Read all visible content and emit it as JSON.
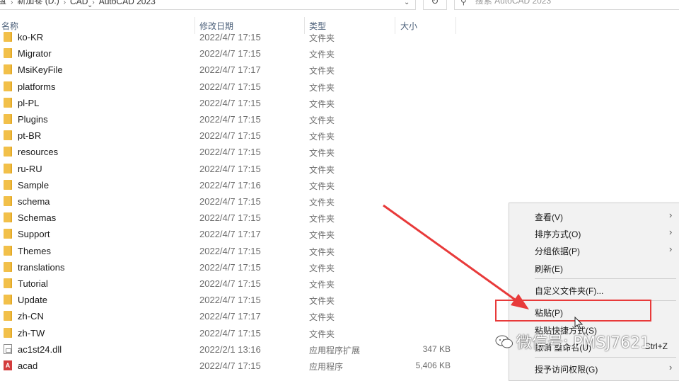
{
  "address": {
    "crumbs": [
      "盘",
      "新加卷 (D:)",
      "CAD",
      "AutoCAD 2023"
    ],
    "search_placeholder": "搜索 AutoCAD 2023"
  },
  "columns": {
    "name": "名称",
    "date": "修改日期",
    "type": "类型",
    "size": "大小"
  },
  "files": [
    {
      "name": "ko-KR",
      "date": "2022/4/7 17:15",
      "type": "文件夹",
      "size": "",
      "icon": "folder-icon"
    },
    {
      "name": "Migrator",
      "date": "2022/4/7 17:15",
      "type": "文件夹",
      "size": "",
      "icon": "folder-icon"
    },
    {
      "name": "MsiKeyFile",
      "date": "2022/4/7 17:17",
      "type": "文件夹",
      "size": "",
      "icon": "folder-icon"
    },
    {
      "name": "platforms",
      "date": "2022/4/7 17:15",
      "type": "文件夹",
      "size": "",
      "icon": "folder-icon"
    },
    {
      "name": "pl-PL",
      "date": "2022/4/7 17:15",
      "type": "文件夹",
      "size": "",
      "icon": "folder-icon"
    },
    {
      "name": "Plugins",
      "date": "2022/4/7 17:15",
      "type": "文件夹",
      "size": "",
      "icon": "folder-icon"
    },
    {
      "name": "pt-BR",
      "date": "2022/4/7 17:15",
      "type": "文件夹",
      "size": "",
      "icon": "folder-icon"
    },
    {
      "name": "resources",
      "date": "2022/4/7 17:15",
      "type": "文件夹",
      "size": "",
      "icon": "folder-icon"
    },
    {
      "name": "ru-RU",
      "date": "2022/4/7 17:15",
      "type": "文件夹",
      "size": "",
      "icon": "folder-icon"
    },
    {
      "name": "Sample",
      "date": "2022/4/7 17:16",
      "type": "文件夹",
      "size": "",
      "icon": "folder-icon"
    },
    {
      "name": "schema",
      "date": "2022/4/7 17:15",
      "type": "文件夹",
      "size": "",
      "icon": "folder-icon"
    },
    {
      "name": "Schemas",
      "date": "2022/4/7 17:15",
      "type": "文件夹",
      "size": "",
      "icon": "folder-icon"
    },
    {
      "name": "Support",
      "date": "2022/4/7 17:17",
      "type": "文件夹",
      "size": "",
      "icon": "folder-icon"
    },
    {
      "name": "Themes",
      "date": "2022/4/7 17:15",
      "type": "文件夹",
      "size": "",
      "icon": "folder-icon"
    },
    {
      "name": "translations",
      "date": "2022/4/7 17:15",
      "type": "文件夹",
      "size": "",
      "icon": "folder-icon"
    },
    {
      "name": "Tutorial",
      "date": "2022/4/7 17:15",
      "type": "文件夹",
      "size": "",
      "icon": "folder-icon"
    },
    {
      "name": "Update",
      "date": "2022/4/7 17:15",
      "type": "文件夹",
      "size": "",
      "icon": "folder-icon"
    },
    {
      "name": "zh-CN",
      "date": "2022/4/7 17:17",
      "type": "文件夹",
      "size": "",
      "icon": "folder-icon"
    },
    {
      "name": "zh-TW",
      "date": "2022/4/7 17:15",
      "type": "文件夹",
      "size": "",
      "icon": "folder-icon"
    },
    {
      "name": "ac1st24.dll",
      "date": "2022/2/1 13:16",
      "type": "应用程序扩展",
      "size": "347 KB",
      "icon": "dll-file-icon"
    },
    {
      "name": "acad",
      "date": "2022/4/7 17:15",
      "type": "应用程序",
      "size": "5,406 KB",
      "icon": "autocad-app-icon"
    }
  ],
  "context_menu": {
    "items": [
      {
        "label": "查看(V)",
        "submenu": true
      },
      {
        "label": "排序方式(O)",
        "submenu": true
      },
      {
        "label": "分组依据(P)",
        "submenu": true
      },
      {
        "label": "刷新(E)",
        "submenu": false
      },
      {
        "label": "自定义文件夹(F)...",
        "submenu": false
      },
      {
        "label": "粘贴(P)",
        "submenu": false
      },
      {
        "label": "粘贴快捷方式(S)",
        "submenu": false
      },
      {
        "label": "撤销 重命名(U)",
        "shortcut": "Ctrl+Z",
        "submenu": false
      },
      {
        "label": "授予访问权限(G)",
        "submenu": true
      }
    ]
  },
  "watermark": "微信号: PMSJ7621",
  "colors": {
    "highlight": "#e83a3a",
    "folder": "#f2c04a"
  }
}
